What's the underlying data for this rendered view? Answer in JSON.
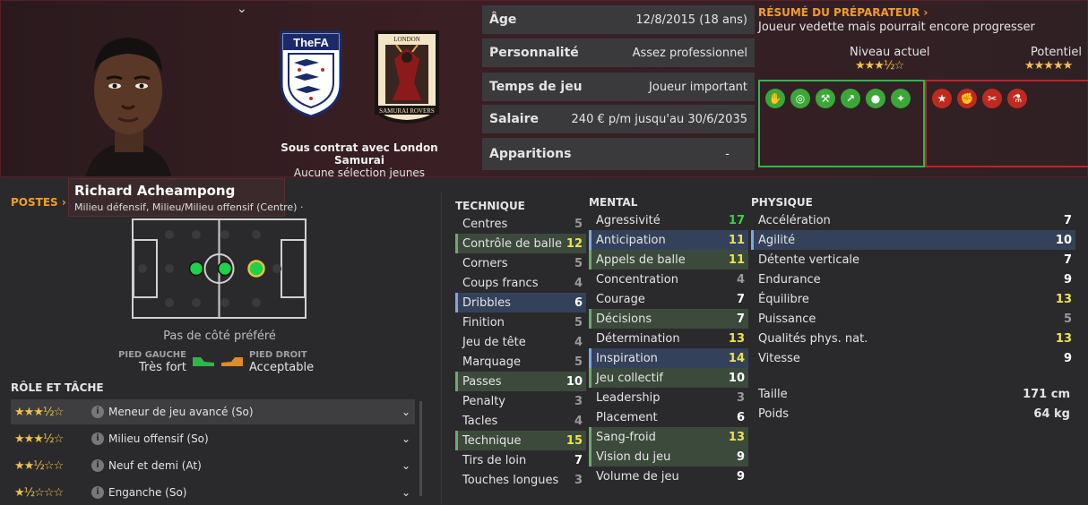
{
  "header": {
    "contract_line1": "Sous contrat avec London Samurai",
    "contract_line2": "Aucune sélection jeunes",
    "fa_label": "TheFA",
    "club_top": "LONDON",
    "club_bottom": "SAMURAI ROVERS"
  },
  "info": [
    {
      "key": "Âge",
      "value": "12/8/2015 (18 ans)"
    },
    {
      "key": "Personnalité",
      "value": "Assez professionnel"
    },
    {
      "key": "Temps de jeu",
      "value": "Joueur important"
    },
    {
      "key": "Salaire",
      "value": "240 € p/m jusqu'au 30/6/2035"
    },
    {
      "key": "Apparitions",
      "value": "-"
    }
  ],
  "coach": {
    "title": "RÉSUMÉ DU PRÉPARATEUR",
    "text": "Joueur vedette mais pourrait encore progresser",
    "current_label": "Niveau actuel",
    "potential_label": "Potentiel",
    "current_stars": "★★★½☆",
    "potential_stars": "★★★★★"
  },
  "player": {
    "name": "Richard Acheampong",
    "positions": "Milieu défensif, Milieu/Milieu offensif (Centre) ·"
  },
  "positions_panel": {
    "title": "POSTES",
    "pref_side": "Pas de côté préféré",
    "left_foot_label": "PIED GAUCHE",
    "left_foot_value": "Très fort",
    "right_foot_label": "PIED DROIT",
    "right_foot_value": "Acceptable"
  },
  "roles": {
    "title": "RÔLE ET TÂCHE",
    "items": [
      {
        "stars": "★★★½☆",
        "label": "Meneur de jeu avancé (So)"
      },
      {
        "stars": "★★★½☆",
        "label": "Milieu offensif (So)"
      },
      {
        "stars": "★★½☆☆",
        "label": "Neuf et demi (At)"
      },
      {
        "stars": "★½☆☆☆",
        "label": "Enganche (So)"
      }
    ]
  },
  "technique": {
    "title": "TECHNIQUE",
    "items": [
      {
        "name": "Centres",
        "value": "5",
        "c": "c-low",
        "hl": ""
      },
      {
        "name": "Contrôle de balle",
        "value": "12",
        "c": "c-high",
        "hl": "hl"
      },
      {
        "name": "Corners",
        "value": "5",
        "c": "c-low",
        "hl": ""
      },
      {
        "name": "Coups francs",
        "value": "4",
        "c": "c-low",
        "hl": ""
      },
      {
        "name": "Dribbles",
        "value": "6",
        "c": "c-mid",
        "hl": "hlb"
      },
      {
        "name": "Finition",
        "value": "5",
        "c": "c-low",
        "hl": ""
      },
      {
        "name": "Jeu de tête",
        "value": "4",
        "c": "c-low",
        "hl": ""
      },
      {
        "name": "Marquage",
        "value": "5",
        "c": "c-low",
        "hl": ""
      },
      {
        "name": "Passes",
        "value": "10",
        "c": "c-mid",
        "hl": "hl"
      },
      {
        "name": "Penalty",
        "value": "3",
        "c": "c-low",
        "hl": ""
      },
      {
        "name": "Tacles",
        "value": "4",
        "c": "c-low",
        "hl": ""
      },
      {
        "name": "Technique",
        "value": "15",
        "c": "c-high",
        "hl": "hl"
      },
      {
        "name": "Tirs de loin",
        "value": "7",
        "c": "c-mid",
        "hl": ""
      },
      {
        "name": "Touches longues",
        "value": "3",
        "c": "c-low",
        "hl": ""
      }
    ]
  },
  "mental": {
    "title": "MENTAL",
    "items": [
      {
        "name": "Agressivité",
        "value": "17",
        "c": "c-top",
        "hl": ""
      },
      {
        "name": "Anticipation",
        "value": "11",
        "c": "c-high",
        "hl": "hlb"
      },
      {
        "name": "Appels de balle",
        "value": "11",
        "c": "c-high",
        "hl": "hl"
      },
      {
        "name": "Concentration",
        "value": "4",
        "c": "c-low",
        "hl": ""
      },
      {
        "name": "Courage",
        "value": "7",
        "c": "c-mid",
        "hl": ""
      },
      {
        "name": "Décisions",
        "value": "7",
        "c": "c-mid",
        "hl": "hl"
      },
      {
        "name": "Détermination",
        "value": "13",
        "c": "c-high",
        "hl": ""
      },
      {
        "name": "Inspiration",
        "value": "14",
        "c": "c-high",
        "hl": "hlb"
      },
      {
        "name": "Jeu collectif",
        "value": "10",
        "c": "c-mid",
        "hl": "hl"
      },
      {
        "name": "Leadership",
        "value": "3",
        "c": "c-low",
        "hl": ""
      },
      {
        "name": "Placement",
        "value": "6",
        "c": "c-mid",
        "hl": ""
      },
      {
        "name": "Sang-froid",
        "value": "13",
        "c": "c-high",
        "hl": "hl"
      },
      {
        "name": "Vision du jeu",
        "value": "9",
        "c": "c-mid",
        "hl": "hl"
      },
      {
        "name": "Volume de jeu",
        "value": "9",
        "c": "c-mid",
        "hl": ""
      }
    ]
  },
  "physique": {
    "title": "PHYSIQUE",
    "items": [
      {
        "name": "Accélération",
        "value": "7",
        "c": "c-mid",
        "hl": ""
      },
      {
        "name": "Agilité",
        "value": "10",
        "c": "c-mid",
        "hl": "hlb"
      },
      {
        "name": "Détente verticale",
        "value": "7",
        "c": "c-mid",
        "hl": ""
      },
      {
        "name": "Endurance",
        "value": "9",
        "c": "c-mid",
        "hl": ""
      },
      {
        "name": "Équilibre",
        "value": "13",
        "c": "c-high",
        "hl": ""
      },
      {
        "name": "Puissance",
        "value": "5",
        "c": "c-low",
        "hl": ""
      },
      {
        "name": "Qualités phys. nat.",
        "value": "13",
        "c": "c-high",
        "hl": ""
      },
      {
        "name": "Vitesse",
        "value": "9",
        "c": "c-mid",
        "hl": ""
      }
    ]
  },
  "body": [
    {
      "name": "Taille",
      "value": "171 cm"
    },
    {
      "name": "Poids",
      "value": "64 kg"
    }
  ],
  "colors": {
    "accent": "#f29d2b",
    "strong": "#2fb54a",
    "weak": "#c2202c",
    "star": "#f0c24a"
  }
}
